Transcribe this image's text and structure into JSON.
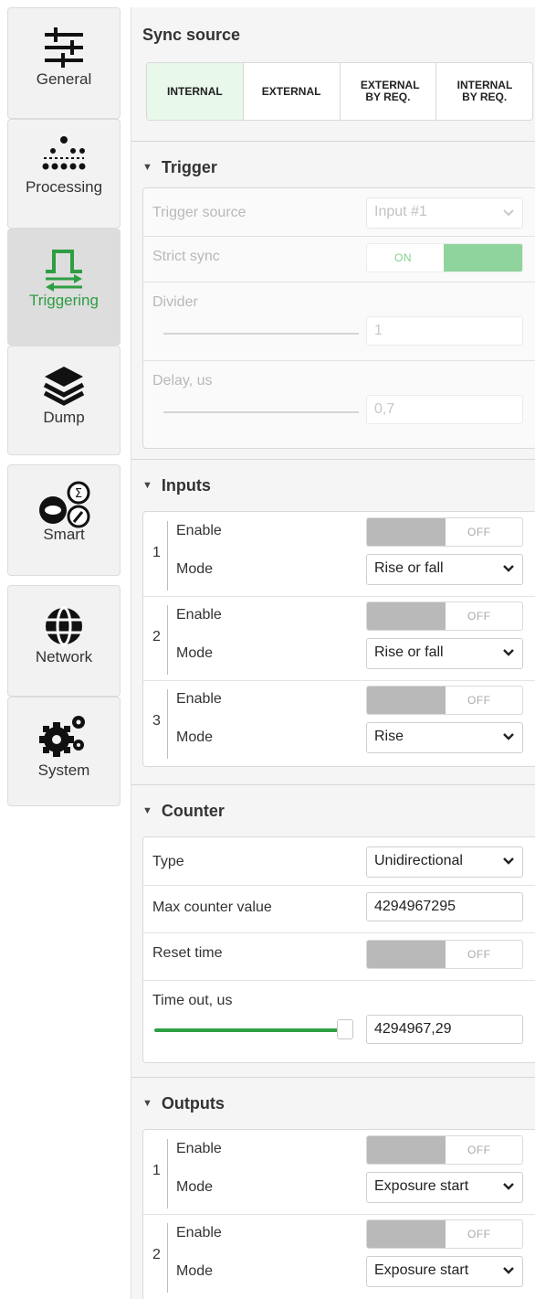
{
  "sidebar": {
    "items": [
      {
        "label": "General",
        "icon": "sliders-icon"
      },
      {
        "label": "Processing",
        "icon": "dots-matrix-icon"
      },
      {
        "label": "Triggering",
        "icon": "trigger-pulse-icon",
        "active": true
      },
      {
        "label": "Dump",
        "icon": "layers-icon"
      },
      {
        "label": "Smart",
        "icon": "smart-ai-icon"
      },
      {
        "label": "Network",
        "icon": "globe-icon"
      },
      {
        "label": "System",
        "icon": "gears-icon"
      }
    ],
    "active_color": "#2e9e43"
  },
  "sync_source": {
    "title": "Sync source",
    "options": [
      "INTERNAL",
      "EXTERNAL",
      "EXTERNAL BY REQ.",
      "INTERNAL BY REQ."
    ],
    "selected": "INTERNAL"
  },
  "trigger": {
    "title": "Trigger",
    "source_label": "Trigger source",
    "source_value": "Input #1",
    "strict_sync_label": "Strict sync",
    "strict_sync_value": "ON",
    "divider_label": "Divider",
    "divider_value": "1",
    "delay_label": "Delay, us",
    "delay_value": "0,7"
  },
  "inputs": {
    "title": "Inputs",
    "enable_label": "Enable",
    "mode_label": "Mode",
    "rows": [
      {
        "index": "1",
        "enable": "OFF",
        "mode": "Rise or fall"
      },
      {
        "index": "2",
        "enable": "OFF",
        "mode": "Rise or fall"
      },
      {
        "index": "3",
        "enable": "OFF",
        "mode": "Rise"
      }
    ]
  },
  "counter": {
    "title": "Counter",
    "type_label": "Type",
    "type_value": "Unidirectional",
    "max_label": "Max counter value",
    "max_value": "4294967295",
    "reset_label": "Reset time",
    "reset_value": "OFF",
    "timeout_label": "Time out, us",
    "timeout_value": "4294967,29",
    "timeout_slider_fraction": 1.0
  },
  "outputs": {
    "title": "Outputs",
    "enable_label": "Enable",
    "mode_label": "Mode",
    "rows": [
      {
        "index": "1",
        "enable": "OFF",
        "mode": "Exposure start"
      },
      {
        "index": "2",
        "enable": "OFF",
        "mode": "Exposure start"
      }
    ]
  }
}
